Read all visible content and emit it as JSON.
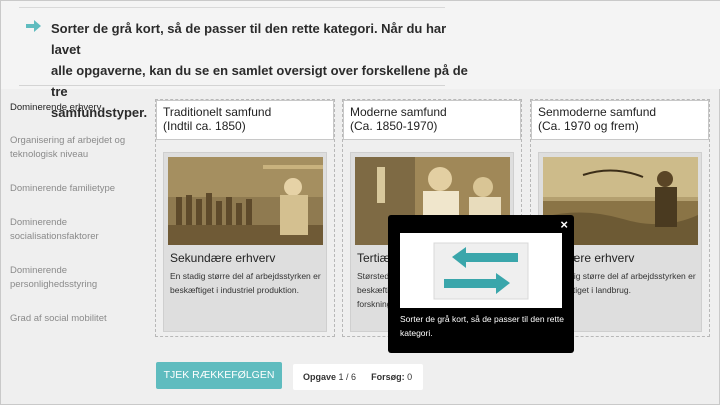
{
  "instruction": {
    "icon": "arrow-right-icon",
    "line1": "Sorter de grå kort, så de passer til den rette kategori. Når du har lavet",
    "line2": "alle opgaverne, kan du se en samlet oversigt over forskellene på de tre",
    "line3": "samfundstyper."
  },
  "sidebar": {
    "items": [
      {
        "label": "Dominerende erhverv",
        "active": true
      },
      {
        "label": "Organisering af arbejdet og teknologisk niveau"
      },
      {
        "label": "Dominerende familietype"
      },
      {
        "label": "Dominerende socialisationsfaktorer"
      },
      {
        "label": "Dominerende personlighedsstyring"
      },
      {
        "label": "Grad af social mobilitet"
      }
    ]
  },
  "categories": [
    {
      "line1": "Traditionelt samfund",
      "line2": "(Indtil ca. 1850)",
      "card": {
        "title": "Sekundære erhverv",
        "desc": "En stadig større del af arbejdsstyrken er beskæftiget i industriel produktion."
      }
    },
    {
      "line1": "Moderne samfund",
      "line2": "(Ca. 1850-1970)",
      "card": {
        "title": "Tertiære erhverv",
        "desc": "Størstedelen af arbejdsstyrken er beskæftiget i service, bank, sundhed, forskning m.m."
      }
    },
    {
      "line1": "Senmoderne samfund",
      "line2": "(Ca. 1970 og frem)",
      "card": {
        "title": "Primære erhverv",
        "desc": "En stadig større del af arbejdsstyrken er beskæftiget i landbrug."
      }
    }
  ],
  "controls": {
    "check_label": "TJEK RÆKKEFØLGEN",
    "task_label": "Opgave",
    "task_value": "1 / 6",
    "attempts_label": "Forsøg:",
    "attempts_value": "0"
  },
  "popup": {
    "icon": "swap-arrows-icon",
    "close_label": "×",
    "text": "Sorter de grå kort, så de passer til den rette kategori."
  },
  "colors": {
    "accent": "#5fbcbf",
    "popup_bg": "#000000",
    "photo_tone": "#b99a5f"
  }
}
